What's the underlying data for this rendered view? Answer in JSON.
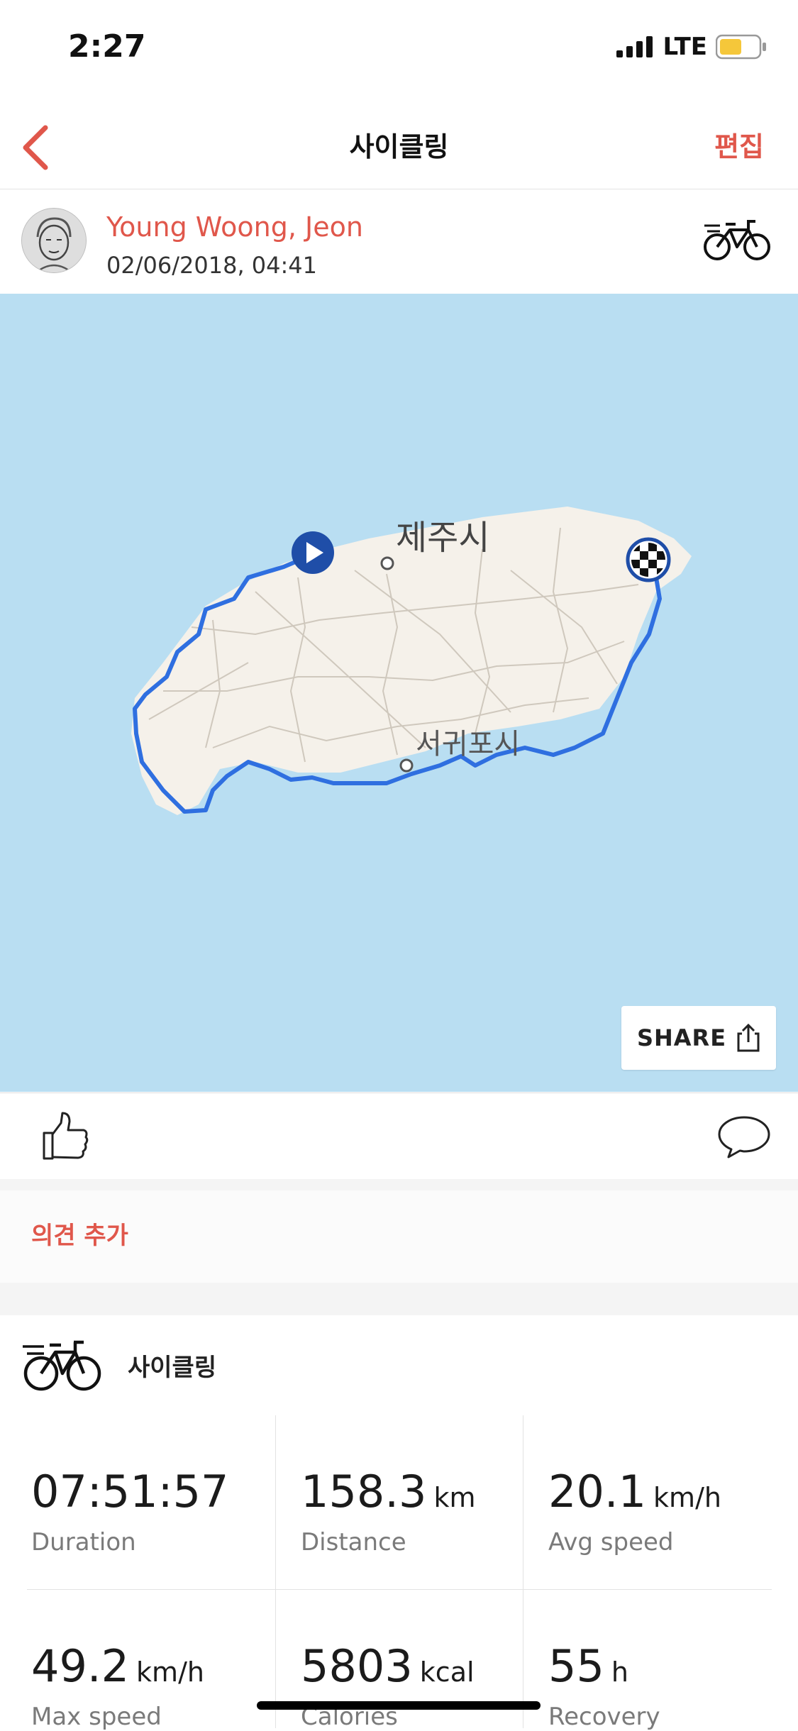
{
  "status_bar": {
    "time": "2:27",
    "network": "LTE"
  },
  "nav": {
    "title": "사이클링",
    "edit_label": "편집"
  },
  "user": {
    "name": "Young Woong, Jeon",
    "date": "02/06/2018, 04:41"
  },
  "map": {
    "city_north": "제주시",
    "city_south": "서귀포시",
    "share_label": "SHARE"
  },
  "comment": {
    "add_label": "의견 추가"
  },
  "activity": {
    "title": "사이클링",
    "stats": [
      {
        "value": "07:51:57",
        "unit": "",
        "label": "Duration"
      },
      {
        "value": "158.3",
        "unit": "km",
        "label": "Distance"
      },
      {
        "value": "20.1",
        "unit": "km/h",
        "label": "Avg speed"
      },
      {
        "value": "49.2",
        "unit": "km/h",
        "label": "Max speed"
      },
      {
        "value": "5803",
        "unit": "kcal",
        "label": "Calories"
      },
      {
        "value": "55",
        "unit": "h",
        "label": "Recovery"
      }
    ]
  },
  "colors": {
    "accent": "#e0574b",
    "map_water": "#b9def2",
    "land": "#f5f1ea",
    "route": "#2f6fe0"
  },
  "icons": [
    "back-chevron-icon",
    "bicycle-icon",
    "play-icon",
    "checkered-flag-icon",
    "share-icon",
    "thumbs-up-icon",
    "comment-icon"
  ]
}
